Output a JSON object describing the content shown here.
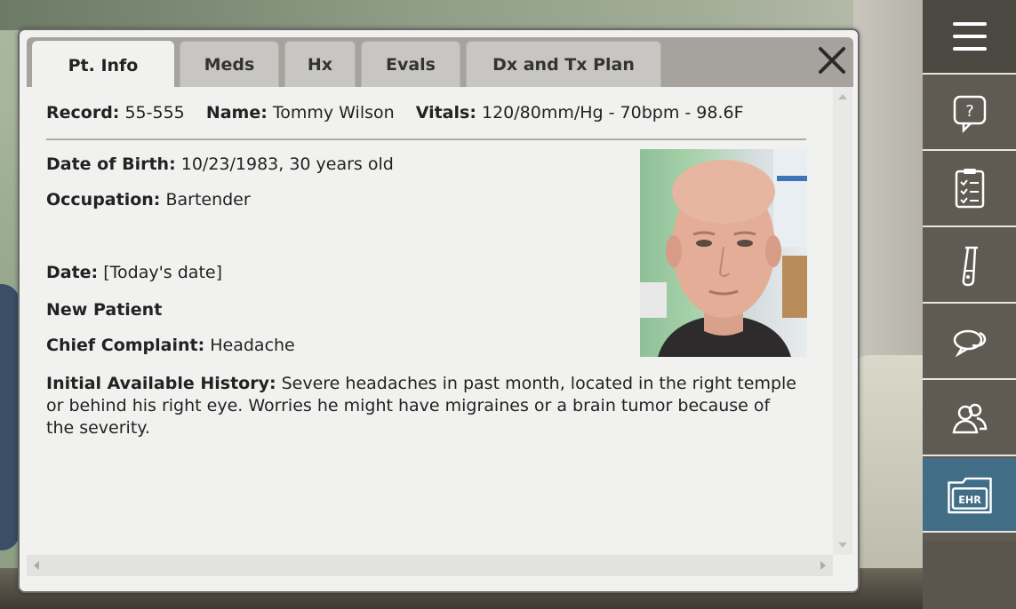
{
  "tabs": [
    {
      "label": "Pt. Info",
      "active": true
    },
    {
      "label": "Meds",
      "active": false
    },
    {
      "label": "Hx",
      "active": false
    },
    {
      "label": "Evals",
      "active": false
    },
    {
      "label": "Dx and Tx Plan",
      "active": false
    }
  ],
  "header": {
    "record_label": "Record:",
    "record_value": "55-555",
    "name_label": "Name:",
    "name_value": "Tommy Wilson",
    "vitals_label": "Vitals:",
    "vitals_value": "120/80mm/Hg - 70bpm - 98.6F"
  },
  "details": {
    "dob_label": "Date of Birth:",
    "dob_value": "10/23/1983, 30 years old",
    "occupation_label": "Occupation:",
    "occupation_value": "Bartender",
    "date_label": "Date:",
    "date_value": "[Today's date]",
    "new_patient": "New Patient",
    "complaint_label": "Chief Complaint:",
    "complaint_value": "Headache",
    "history_label": "Initial Available History:",
    "history_value": "Severe headaches in past month, located in the right temple or behind his right eye. Worries he might have migraines or a brain tumor because of the severity."
  },
  "toolbar": {
    "items": [
      "menu-icon",
      "help-icon",
      "checklist-icon",
      "test-tube-icon",
      "chat-icon",
      "people-icon",
      "ehr-folder-icon"
    ],
    "ehr_label": "EHR",
    "help_label": "?"
  },
  "colors": {
    "toolbar_bg": "#5f5a52",
    "ehr_active": "#416e86",
    "tab_inactive": "#c8c6c3",
    "panel_bg": "#f1f1f0"
  }
}
